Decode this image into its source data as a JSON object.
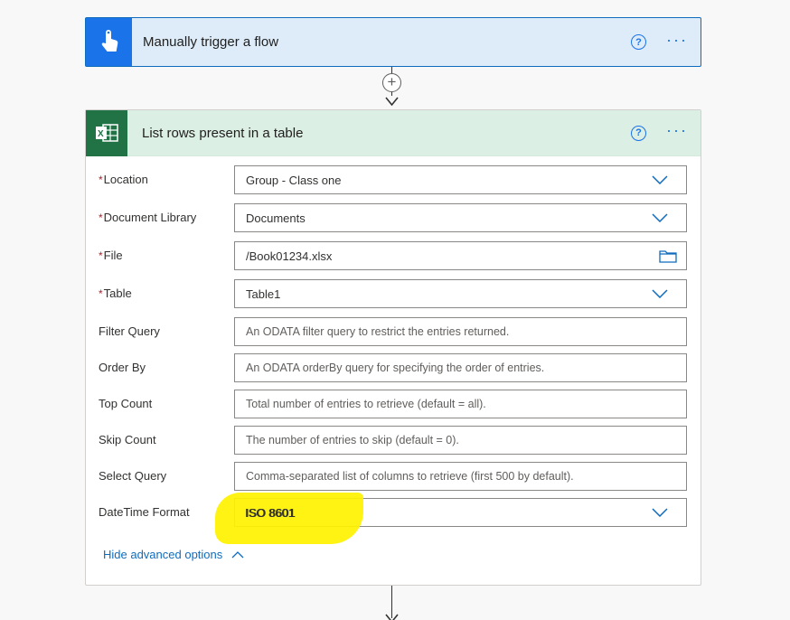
{
  "trigger": {
    "title": "Manually trigger a flow",
    "help_icon": "question-circle-icon",
    "more_icon": "more-ellipsis-icon",
    "more_label": "···",
    "help_label": "?"
  },
  "connector": {
    "add_label": "+"
  },
  "action": {
    "title": "List rows present in a table",
    "help_label": "?",
    "more_label": "···",
    "fields": [
      {
        "label": "Location",
        "required": true,
        "value": "Group - Class one",
        "placeholder": "",
        "control": "dropdown"
      },
      {
        "label": "Document Library",
        "required": true,
        "value": "Documents",
        "placeholder": "",
        "control": "dropdown"
      },
      {
        "label": "File",
        "required": true,
        "value": "/Book01234.xlsx",
        "placeholder": "",
        "control": "file-picker"
      },
      {
        "label": "Table",
        "required": true,
        "value": "Table1",
        "placeholder": "",
        "control": "dropdown"
      },
      {
        "label": "Filter Query",
        "required": false,
        "value": "",
        "placeholder": "An ODATA filter query to restrict the entries returned.",
        "control": "text"
      },
      {
        "label": "Order By",
        "required": false,
        "value": "",
        "placeholder": "An ODATA orderBy query for specifying the order of entries.",
        "control": "text"
      },
      {
        "label": "Top Count",
        "required": false,
        "value": "",
        "placeholder": "Total number of entries to retrieve (default = all).",
        "control": "text"
      },
      {
        "label": "Skip Count",
        "required": false,
        "value": "",
        "placeholder": "The number of entries to skip (default = 0).",
        "control": "text"
      },
      {
        "label": "Select Query",
        "required": false,
        "value": "",
        "placeholder": "Comma-separated list of columns to retrieve (first 500 by default).",
        "control": "text"
      },
      {
        "label": "DateTime Format",
        "required": false,
        "value": "ISO 8601",
        "placeholder": "",
        "control": "dropdown"
      }
    ],
    "advanced_label": "Hide advanced options"
  },
  "colors": {
    "trigger_accent": "#1a73e8",
    "excel_accent": "#217346",
    "highlight": "#fff200",
    "required_asterisk": "#a4262c",
    "link": "#0f6cbd"
  }
}
